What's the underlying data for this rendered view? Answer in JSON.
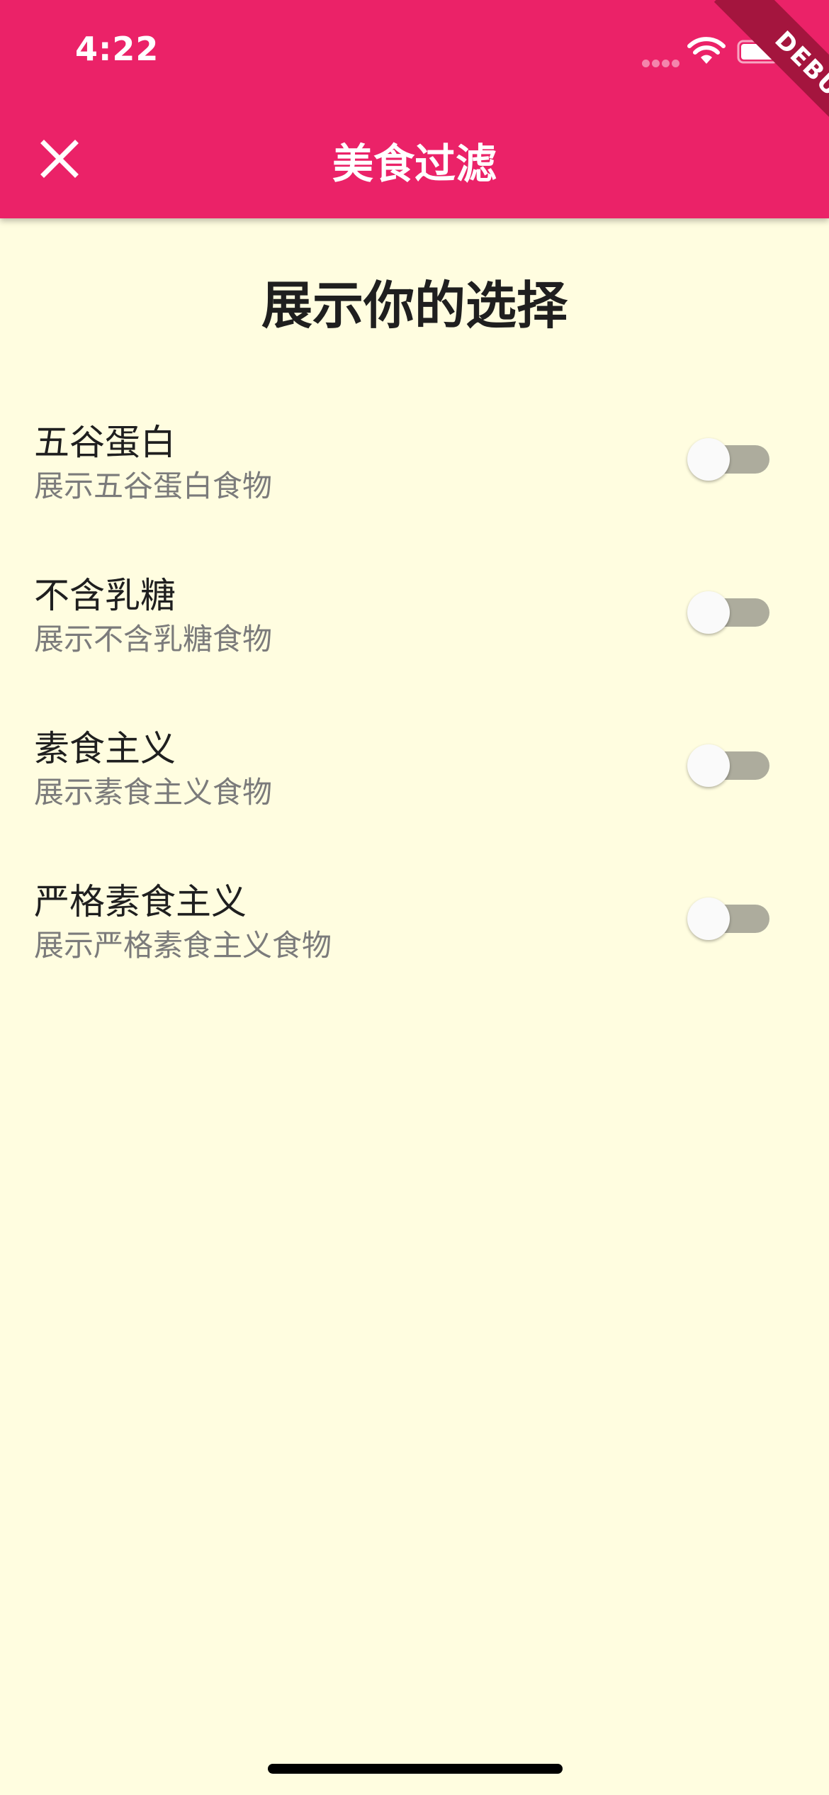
{
  "status_bar": {
    "time": "4:22"
  },
  "debug_banner": "DEBUG",
  "app_bar": {
    "title": "美食过滤",
    "close_icon": "close-icon",
    "background": "#EB2268"
  },
  "page": {
    "title": "展示你的选择",
    "background": "#FFFDE0"
  },
  "filters": [
    {
      "title": "五谷蛋白",
      "subtitle": "展示五谷蛋白食物",
      "on": false
    },
    {
      "title": "不含乳糖",
      "subtitle": "展示不含乳糖食物",
      "on": false
    },
    {
      "title": "素食主义",
      "subtitle": "展示素食主义食物",
      "on": false
    },
    {
      "title": "严格素食主义",
      "subtitle": "展示严格素食主义食物",
      "on": false
    }
  ]
}
